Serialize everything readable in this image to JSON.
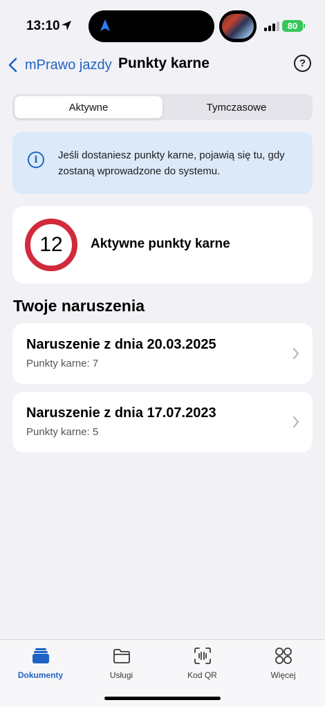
{
  "status_bar": {
    "time": "13:10",
    "battery": "80"
  },
  "nav": {
    "back_label": "mPrawo jazdy",
    "title": "Punkty karne",
    "help_label": "?"
  },
  "tabs": [
    {
      "label": "Aktywne",
      "selected": true
    },
    {
      "label": "Tymczasowe",
      "selected": false
    }
  ],
  "info": {
    "icon_label": "i",
    "text": "Jeśli dostaniesz punkty karne, pojawią się tu, gdy zostaną wprowadzone do systemu."
  },
  "points": {
    "value": "12",
    "label": "Aktywne punkty karne"
  },
  "violations_section": {
    "title": "Twoje naruszenia",
    "items": [
      {
        "title": "Naruszenie z dnia 20.03.2025",
        "subtitle": "Punkty karne: 7"
      },
      {
        "title": "Naruszenie z dnia 17.07.2023",
        "subtitle": "Punkty karne: 5"
      }
    ]
  },
  "tabbar": {
    "items": [
      {
        "label": "Dokumenty",
        "icon": "documents-icon",
        "active": true
      },
      {
        "label": "Usługi",
        "icon": "folder-icon",
        "active": false
      },
      {
        "label": "Kod QR",
        "icon": "qr-scan-icon",
        "active": false
      },
      {
        "label": "Więcej",
        "icon": "more-grid-icon",
        "active": false
      }
    ]
  },
  "colors": {
    "accent": "#1f63c6",
    "points_ring": "#d12a3c",
    "info_background": "#dbe9f8",
    "battery": "#34c759"
  }
}
